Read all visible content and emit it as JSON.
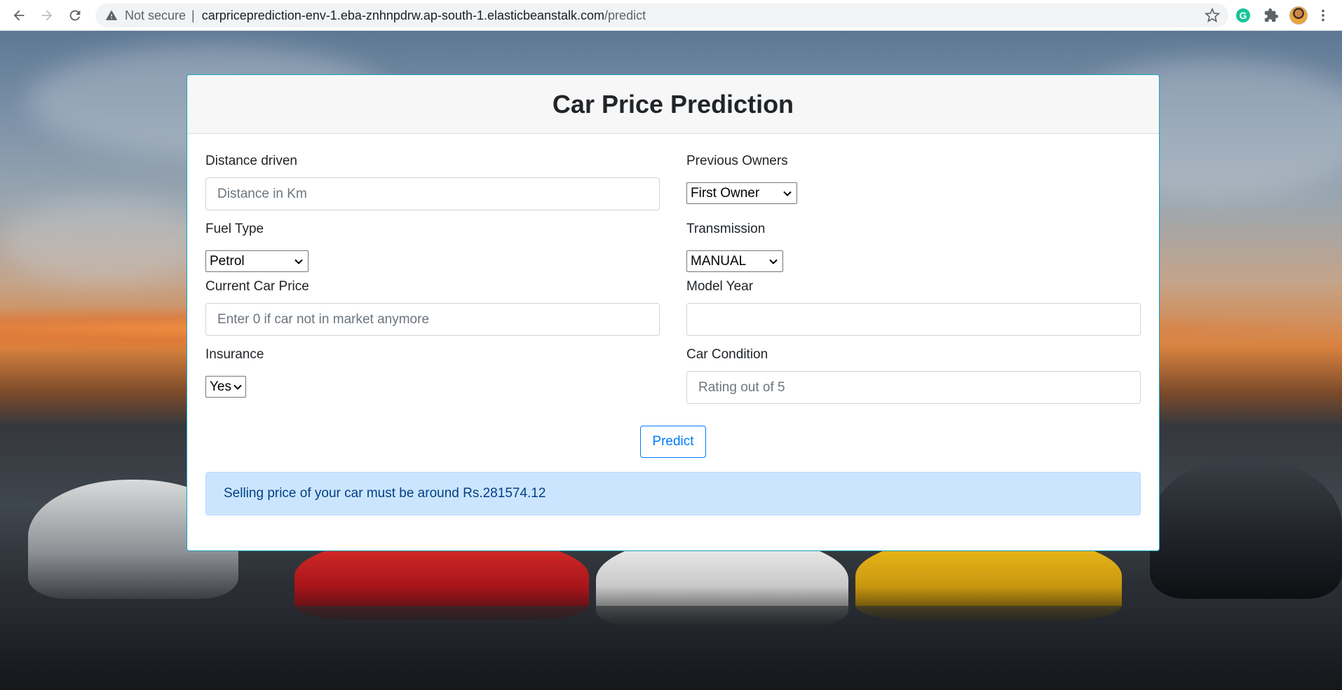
{
  "browser": {
    "security_label": "Not secure",
    "url_host": "carpriceprediction-env-1.eba-znhnpdrw.ap-south-1.elasticbeanstalk.com",
    "url_path": "/predict"
  },
  "form": {
    "title": "Car Price Prediction",
    "distance": {
      "label": "Distance driven",
      "placeholder": "Distance in Km",
      "value": ""
    },
    "owners": {
      "label": "Previous Owners",
      "selected": "First Owner"
    },
    "fuel": {
      "label": "Fuel Type",
      "selected": "Petrol"
    },
    "transmission": {
      "label": "Transmission",
      "selected": "MANUAL"
    },
    "current_price": {
      "label": "Current Car Price",
      "placeholder": "Enter 0 if car not in market anymore",
      "value": ""
    },
    "model_year": {
      "label": "Model Year",
      "placeholder": "",
      "value": ""
    },
    "insurance": {
      "label": "Insurance",
      "selected": "Yes"
    },
    "condition": {
      "label": "Car Condition",
      "placeholder": "Rating out of 5",
      "value": ""
    },
    "predict_label": "Predict",
    "result_text": "Selling price of your car must be around Rs.281574.12"
  },
  "colors": {
    "card_border": "#17a2b8",
    "primary": "#007bff",
    "alert_bg": "#cce5ff",
    "alert_text": "#004085"
  },
  "icons": [
    "back-icon",
    "forward-icon",
    "reload-icon",
    "warning-icon",
    "star-icon",
    "grammarly-icon",
    "extensions-icon",
    "profile-avatar",
    "more-icon",
    "chevron-down-icon"
  ]
}
